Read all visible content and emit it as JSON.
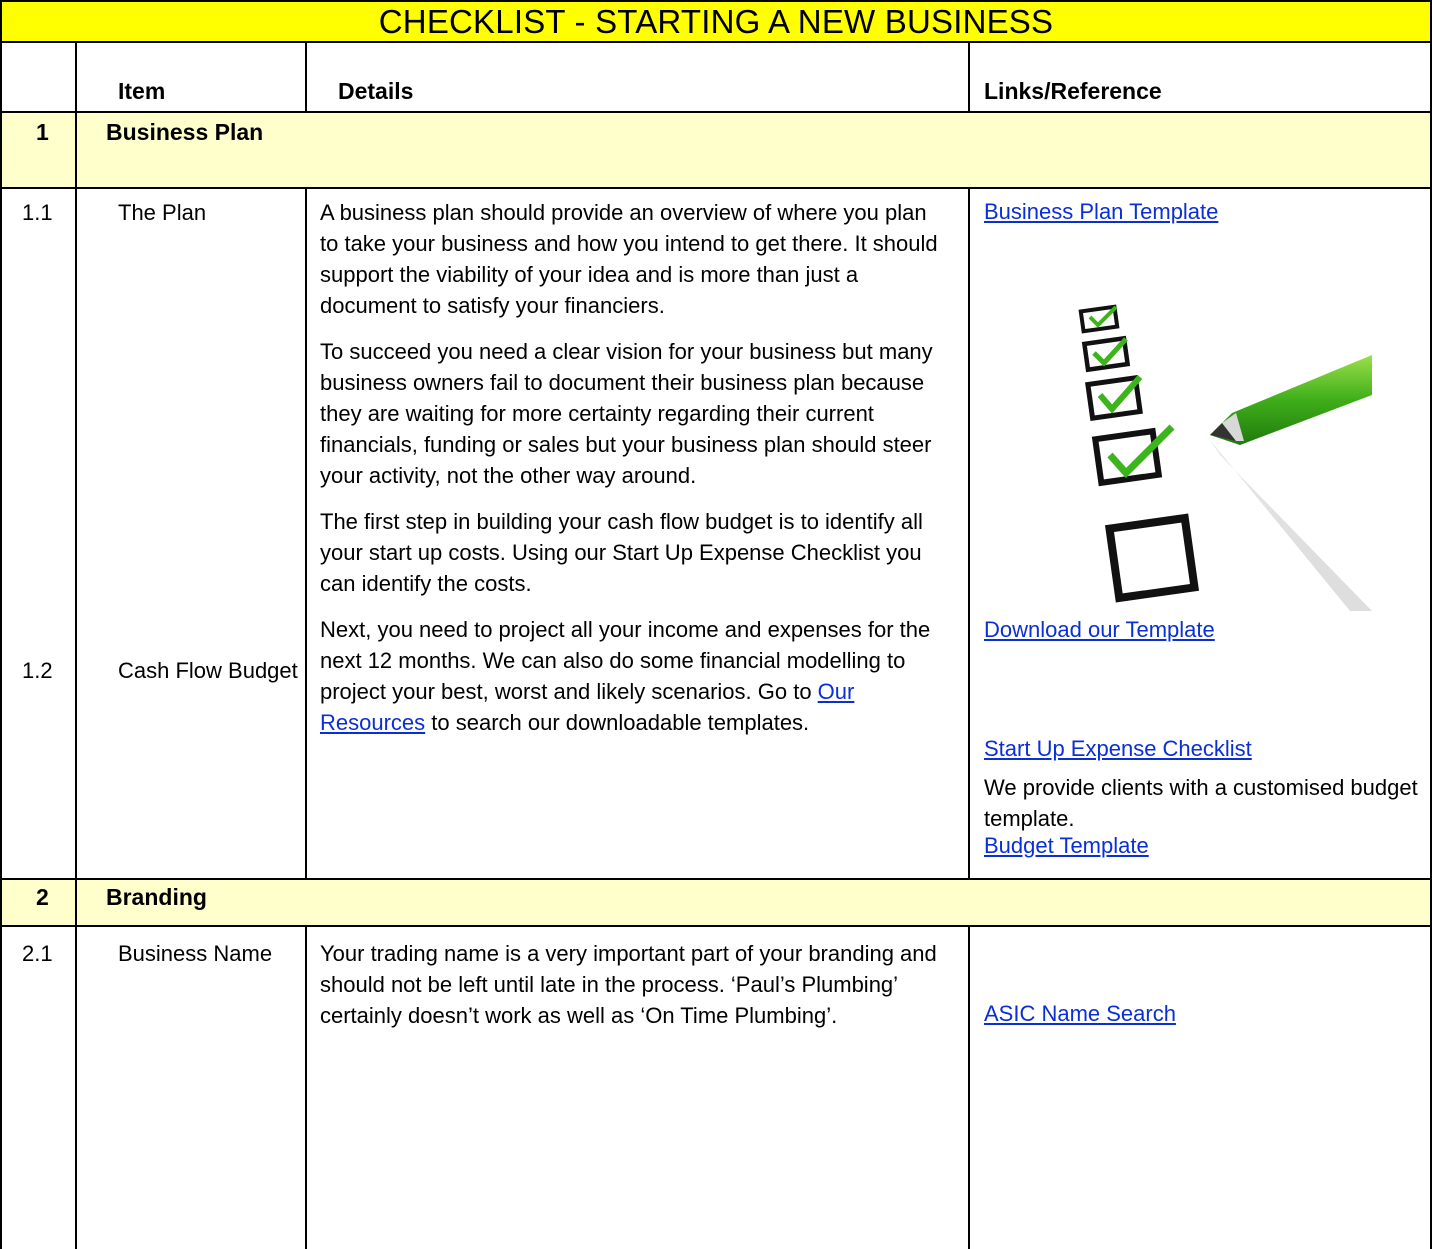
{
  "title": "CHECKLIST - STARTING A NEW BUSINESS",
  "header": {
    "item": "Item",
    "details": "Details",
    "links": "Links/Reference"
  },
  "sections": [
    {
      "number": "1",
      "title": "Business Plan"
    },
    {
      "number": "2",
      "title": "Branding"
    }
  ],
  "rows": {
    "r1_1": {
      "number": "1.1",
      "item": "The Plan",
      "details": [
        "A business plan should provide an overview of where you plan to take your business and how you intend to get there. It should support the viability of your idea and is more than just a document to satisfy your financiers.",
        "To succeed you need a clear vision for your business but many business owners fail to document their business plan because they are waiting for more certainty regarding their current financials, funding or sales but your business plan should steer your activity, not the other way around.",
        "The first step in building your cash flow budget is to identify all your start up costs. Using our Start Up Expense Checklist you can identify the costs."
      ]
    },
    "r1_2": {
      "number": "1.2",
      "item": "Cash Flow Budget",
      "details_before": "Next, you need to project all your income and expenses for the next 12 months. We can also do some financial modelling to project your best, worst and likely scenarios. Go to ",
      "details_link": "Our Resources",
      "details_after": " to search our downloadable templates."
    },
    "r2_1": {
      "number": "2.1",
      "item": "Business Name",
      "details": "Your trading name is a very important part of your branding and should not be left until late in the process.  ‘Paul’s Plumbing’ certainly doesn’t work as well as ‘On Time Plumbing’."
    }
  },
  "links": {
    "business_plan_template": "Business Plan Template",
    "download_template": "Download our Template",
    "start_up_expense": "Start Up Expense Checklist",
    "budget_template": "Budget Template",
    "budget_note": "We provide clients with a customised budget template.",
    "asic_name_search": "ASIC  Name Search"
  },
  "colors": {
    "title_bg": "#ffff00",
    "section_bg": "#ffffcc",
    "link": "#0b2fd6"
  },
  "image": {
    "icon": "checklist-pen-illustration"
  }
}
